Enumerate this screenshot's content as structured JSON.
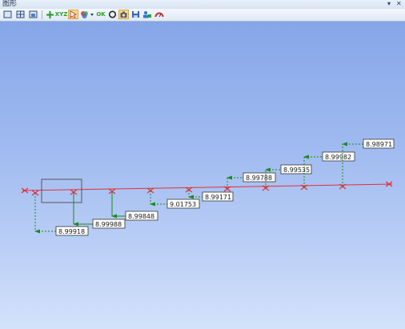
{
  "window": {
    "title": "图形",
    "pin_icon": "pin-icon",
    "close_icon": "close-icon"
  },
  "toolbar": {
    "xyz_label": "XYZ",
    "ok_label": "OK",
    "icons": [
      "view-single-icon",
      "view-multi-icon",
      "view-fit-icon",
      "add-point-icon",
      "xyz-icon",
      "select-tool-icon",
      "color-icon",
      "dropdown-arrow-icon",
      "ok-icon",
      "circle-icon",
      "camera-icon",
      "save-icon",
      "person-icon",
      "gauge-icon"
    ]
  },
  "colors": {
    "profile_line": "#e0303c",
    "leader": "#1a8a1a",
    "label_bg": "#ffffff",
    "label_border": "#333333"
  },
  "measurements": [
    "8.99918",
    "8.99988",
    "8.99848",
    "9.01753",
    "8.99171",
    "8.99788",
    "8.99535",
    "8.99982",
    "8.98971"
  ]
}
